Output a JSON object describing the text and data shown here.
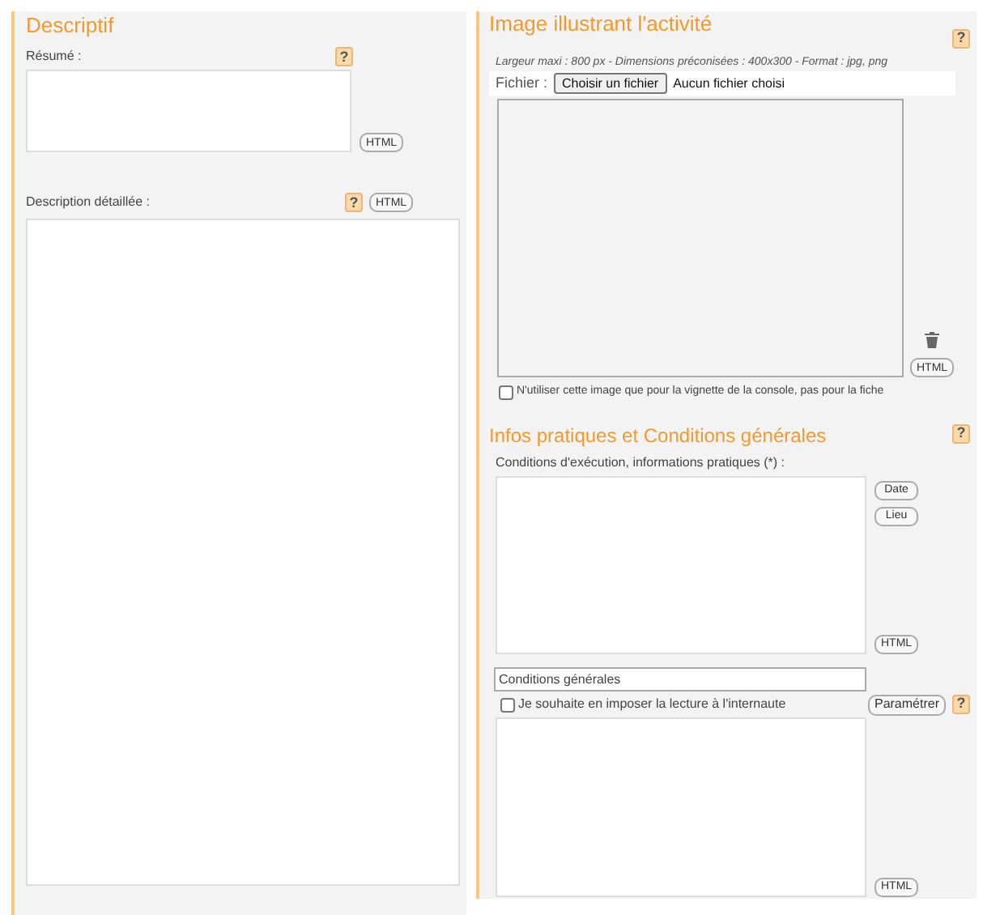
{
  "descriptif": {
    "title": "Descriptif",
    "resume": {
      "label": "Résumé :",
      "help": "?",
      "html_button": "HTML"
    },
    "description": {
      "label": "Description détaillée :",
      "help": "?",
      "html_button": "HTML"
    }
  },
  "image": {
    "title": "Image illustrant l'activité",
    "help": "?",
    "hint": "Largeur maxi : 800 px - Dimensions préconisées : 400x300 - Format : jpg, png",
    "file_label": "Fichier :",
    "file_button": "Choisir un fichier",
    "file_status": "Aucun fichier choisi",
    "html_button": "HTML",
    "thumbnail_only": {
      "label": "N'utiliser cette image que pour la vignette de la console, pas pour la fiche",
      "checked": false
    }
  },
  "infos": {
    "title": "Infos pratiques et Conditions générales",
    "help": "?",
    "conditions_label": "Conditions d'exécution, informations pratiques (*) :",
    "side_buttons": [
      "Date",
      "Lieu"
    ],
    "html_button": "HTML",
    "general_field": {
      "value": "Conditions générales"
    },
    "impose": {
      "label": "Je souhaite en imposer la lecture à l'internaute",
      "checked": false
    },
    "settings_button": "Paramétrer",
    "settings_help": "?",
    "general_html_button": "HTML"
  }
}
